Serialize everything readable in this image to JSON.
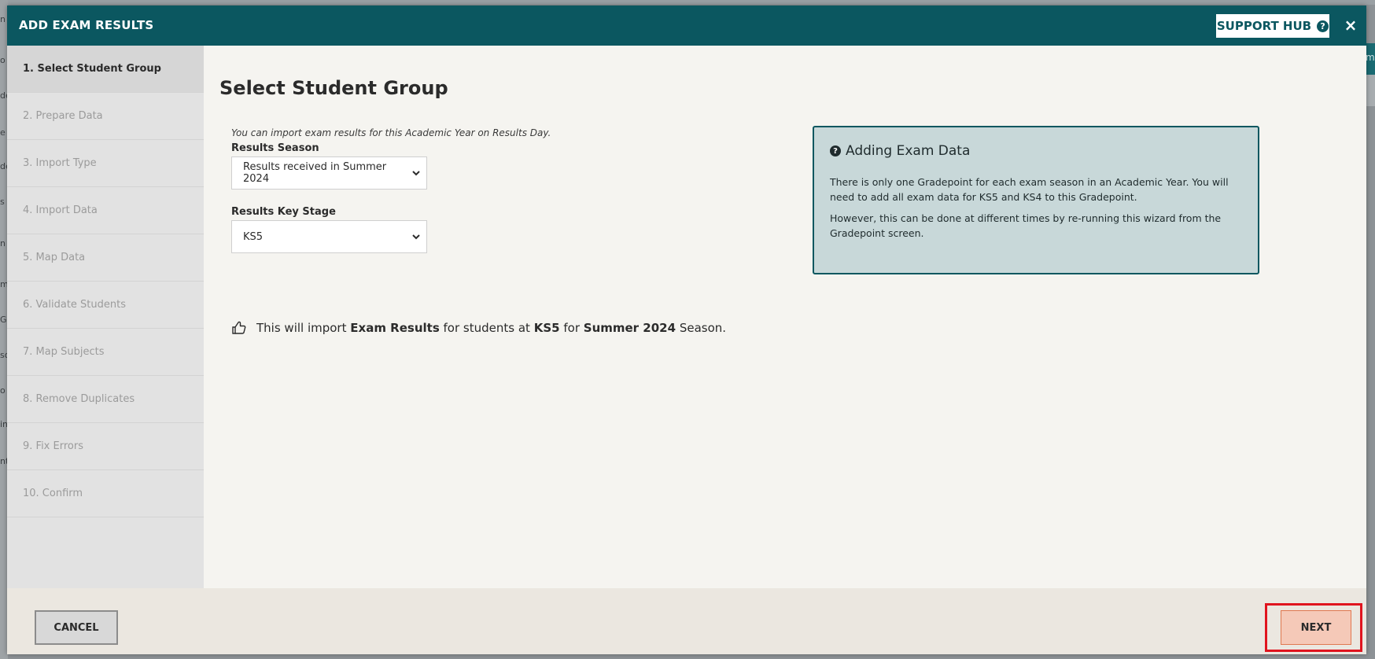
{
  "modal": {
    "title": "ADD EXAM RESULTS",
    "support_label": "SUPPORT HUB",
    "close_glyph": "×"
  },
  "steps": [
    {
      "label": "1. Select Student Group",
      "active": true
    },
    {
      "label": "2. Prepare Data",
      "active": false
    },
    {
      "label": "3. Import Type",
      "active": false
    },
    {
      "label": "4. Import Data",
      "active": false
    },
    {
      "label": "5. Map Data",
      "active": false
    },
    {
      "label": "6. Validate Students",
      "active": false
    },
    {
      "label": "7. Map Subjects",
      "active": false
    },
    {
      "label": "8. Remove Duplicates",
      "active": false
    },
    {
      "label": "9. Fix Errors",
      "active": false
    },
    {
      "label": "10. Confirm",
      "active": false
    }
  ],
  "main": {
    "title": "Select Student Group",
    "hint": "You can import exam results for this Academic Year on Results Day.",
    "season_label": "Results Season",
    "season_value": "Results received in Summer 2024",
    "keystage_label": "Results Key Stage",
    "keystage_value": "KS5",
    "summary": {
      "prefix": "This will import",
      "bold1": "Exam Results",
      "mid1": "for students at",
      "bold2": "KS5",
      "mid2": "for",
      "bold3": "Summer 2024",
      "suffix": "Season."
    }
  },
  "info": {
    "title": "Adding Exam Data",
    "para1": "There is only one Gradepoint for each exam season in an Academic Year. You will need to add all exam data for KS5 and KS4 to this Gradepoint.",
    "para2": "However, this can be done at different times by re-running this wizard from the Gradepoint screen."
  },
  "footer": {
    "cancel_label": "CANCEL",
    "next_label": "NEXT"
  },
  "background": {
    "peek_chars": [
      "n",
      "o",
      "de",
      "e",
      "de",
      "s F",
      "n",
      "m",
      "G",
      "so",
      "o",
      "in",
      "nt"
    ],
    "right_peek": "m"
  },
  "colors": {
    "header_bg": "#0b5760",
    "highlight": "#e0141e",
    "next_bg": "#f5c9b8",
    "info_bg": "#c8d8d9"
  }
}
